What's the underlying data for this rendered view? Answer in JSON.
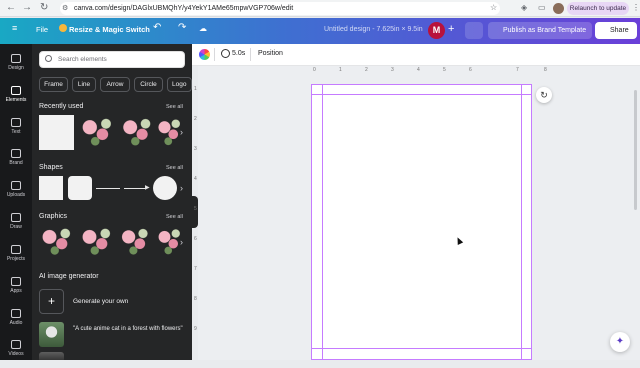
{
  "browser": {
    "url": "canva.com/design/DAGlxUBMQhY/y4YekY1AMe65mpwVGP706w/edit",
    "relaunch_label": "Relaunch to update",
    "relaunch_menu": "⋮"
  },
  "topbar": {
    "menu_icon": "≡",
    "file_label": "File",
    "resize_label": "Resize & Magic Switch",
    "undo": "↶",
    "redo": "↷",
    "doc_title": "Untitled design - 7.625in × 9.5in",
    "avatar_letter": "M",
    "add": "+",
    "publish_label": "Publish as Brand Template",
    "share_label": "Share"
  },
  "rail": {
    "items": [
      {
        "label": "Design"
      },
      {
        "label": "Elements"
      },
      {
        "label": "Text"
      },
      {
        "label": "Brand"
      },
      {
        "label": "Uploads"
      },
      {
        "label": "Draw"
      },
      {
        "label": "Projects"
      },
      {
        "label": "Apps"
      },
      {
        "label": "Audio"
      },
      {
        "label": "Videos"
      }
    ]
  },
  "panel": {
    "search_placeholder": "Search elements",
    "pills": [
      "Frame",
      "Line",
      "Arrow",
      "Circle",
      "Logo"
    ],
    "sections": {
      "recent": "Recently used",
      "shapes": "Shapes",
      "graphics": "Graphics",
      "ai": "AI image generator"
    },
    "see_all": "See all",
    "generate_label": "Generate your own",
    "prompt": "\"A cute anime cat in a forest with flowers\""
  },
  "toolbar": {
    "duration": "5.0s",
    "position_label": "Position"
  },
  "rulers": {
    "top": [
      "0",
      "1",
      "2",
      "3",
      "4",
      "5",
      "6",
      "7",
      "8"
    ],
    "left": [
      "1",
      "2",
      "3",
      "4",
      "5",
      "6",
      "7",
      "8",
      "9"
    ]
  }
}
